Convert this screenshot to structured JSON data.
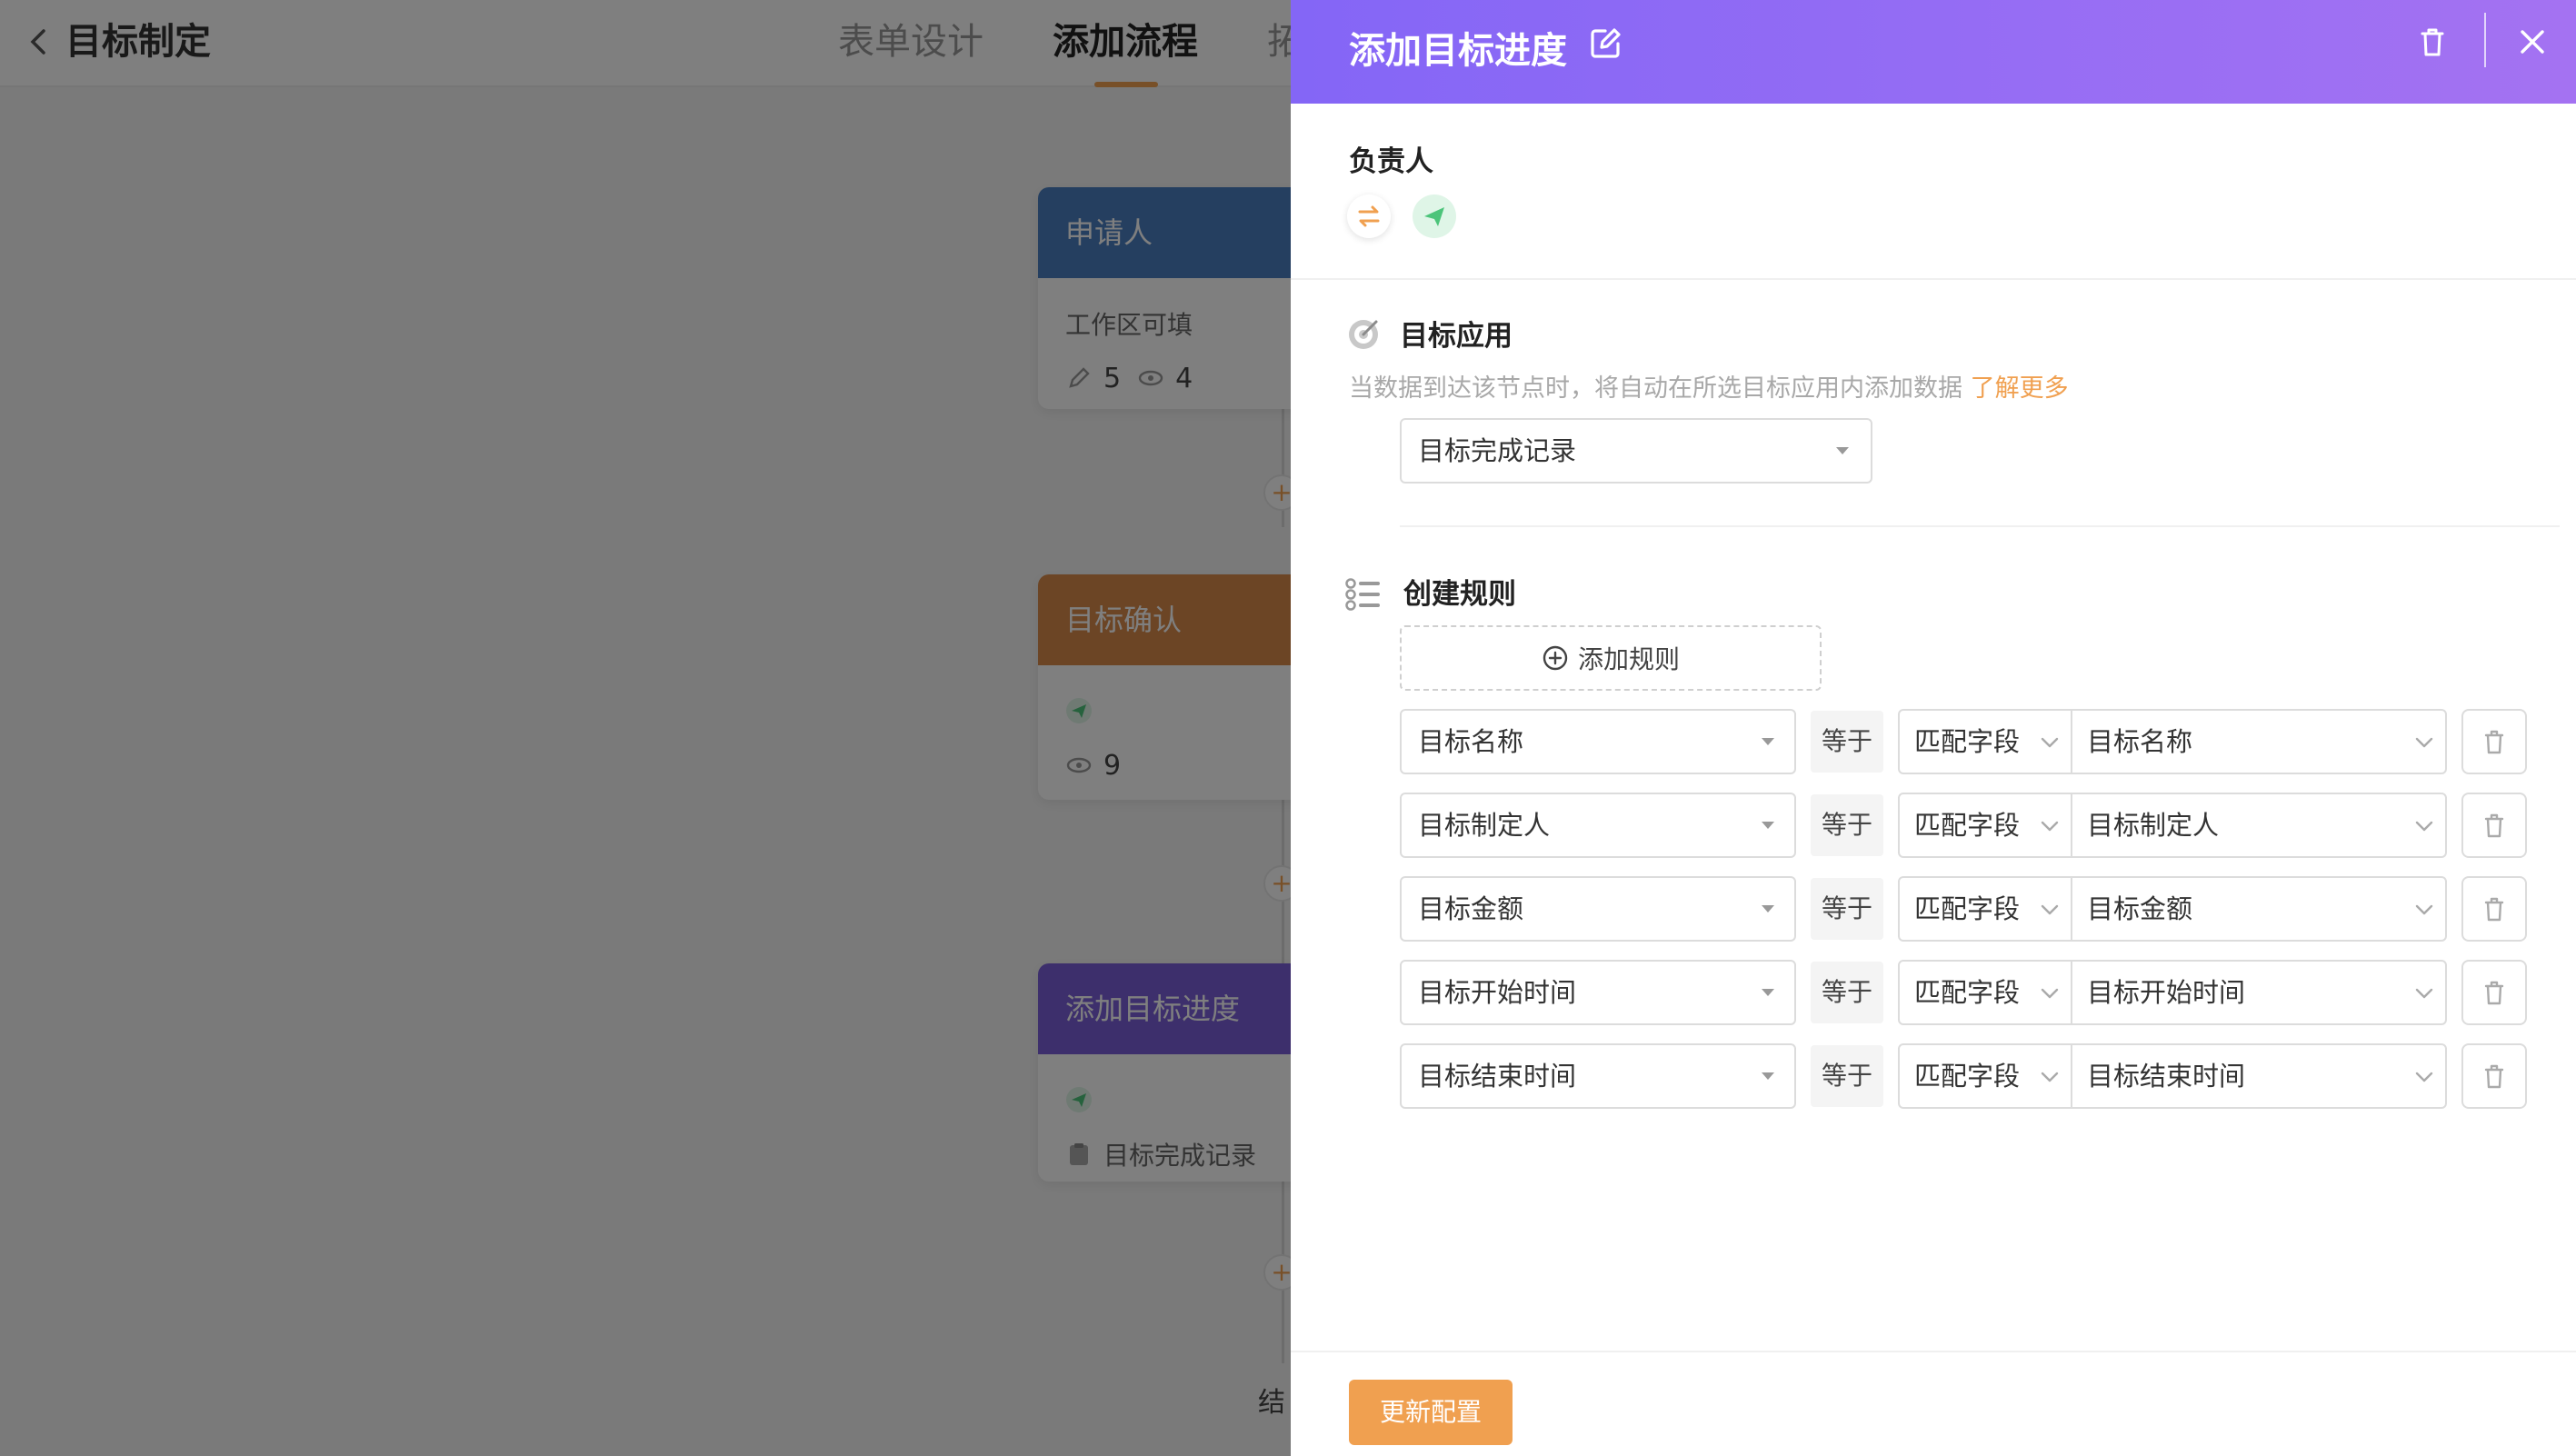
{
  "app": {
    "title": "目标制定",
    "tabs": [
      "表单设计",
      "添加流程",
      "拓"
    ],
    "active_tab": 1
  },
  "flow": {
    "nodes": [
      {
        "title": "申请人",
        "color": "#4a7ec0",
        "line1": "工作区可填",
        "edit_count": "5",
        "view_count": "4"
      },
      {
        "title": "目标确认",
        "color": "#d98a4a",
        "view_count": "9"
      },
      {
        "title": "添加目标进度",
        "color": "#7a5fd8",
        "record": "目标完成记录"
      }
    ],
    "end_label": "结"
  },
  "drawer": {
    "title": "添加目标进度",
    "owner": {
      "label": "负责人"
    },
    "target_app": {
      "label": "目标应用",
      "hint": "当数据到达该节点时，将自动在所选目标应用内添加数据",
      "learn_more": "了解更多",
      "selected": "目标完成记录"
    },
    "rules": {
      "label": "创建规则",
      "add_label": "添加规则",
      "items": [
        {
          "field": "目标名称",
          "op": "等于",
          "mode": "匹配字段",
          "value": "目标名称"
        },
        {
          "field": "目标制定人",
          "op": "等于",
          "mode": "匹配字段",
          "value": "目标制定人"
        },
        {
          "field": "目标金额",
          "op": "等于",
          "mode": "匹配字段",
          "value": "目标金额"
        },
        {
          "field": "目标开始时间",
          "op": "等于",
          "mode": "匹配字段",
          "value": "目标开始时间"
        },
        {
          "field": "目标结束时间",
          "op": "等于",
          "mode": "匹配字段",
          "value": "目标结束时间"
        }
      ]
    },
    "submit_label": "更新配置"
  },
  "colors": {
    "accent": "#f0a050",
    "header_start": "#8466f6",
    "header_end": "#a472f2",
    "green": "#4cc47a"
  }
}
